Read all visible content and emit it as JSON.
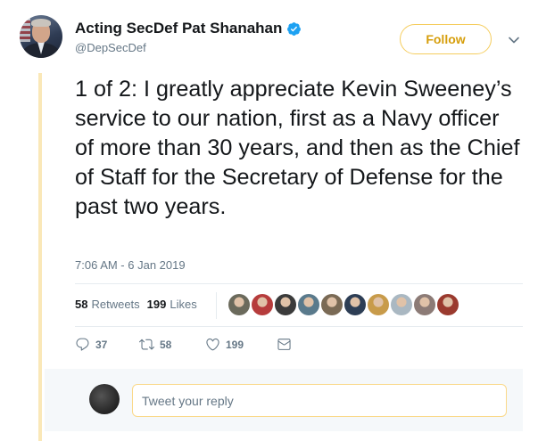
{
  "author": {
    "display_name": "Acting SecDef Pat Shanahan",
    "handle": "@DepSecDef",
    "verified": true
  },
  "follow_label": "Follow",
  "tweet": {
    "text": "1 of 2: I greatly appreciate Kevin Sweeney’s service to our nation, first as a Navy officer of more than 30 years, and then as the Chief of Staff for the Secretary of Defense for the past two years.",
    "timestamp": "7:06 AM - 6 Jan 2019"
  },
  "stats": {
    "retweets_count": "58",
    "retweets_label": "Retweets",
    "likes_count": "199",
    "likes_label": "Likes"
  },
  "likers": [
    {
      "name": "liker-1",
      "color": "#6b6a5c"
    },
    {
      "name": "liker-2",
      "color": "#b63c3c"
    },
    {
      "name": "liker-3",
      "color": "#3b3b3b"
    },
    {
      "name": "liker-4",
      "color": "#5a7a8c"
    },
    {
      "name": "liker-5",
      "color": "#7a6a55"
    },
    {
      "name": "liker-6",
      "color": "#2d3e55"
    },
    {
      "name": "liker-7",
      "color": "#c89b4a"
    },
    {
      "name": "liker-8",
      "color": "#aab8c2"
    },
    {
      "name": "liker-9",
      "color": "#8c7b76"
    },
    {
      "name": "liker-10",
      "color": "#9a3a2e"
    }
  ],
  "actions": {
    "replies": "37",
    "retweets": "58",
    "likes": "199"
  },
  "reply": {
    "placeholder": "Tweet your reply"
  },
  "colors": {
    "accent": "#d69e0b",
    "follow_border": "#f5cd5e",
    "verified": "#1da1f2",
    "thread_line": "#fae8b8",
    "muted_text": "#657786"
  },
  "icons": {
    "verified": "verified-badge-icon",
    "caret": "chevron-down-icon",
    "reply": "reply-icon",
    "retweet": "retweet-icon",
    "like": "heart-icon",
    "message": "envelope-icon"
  }
}
